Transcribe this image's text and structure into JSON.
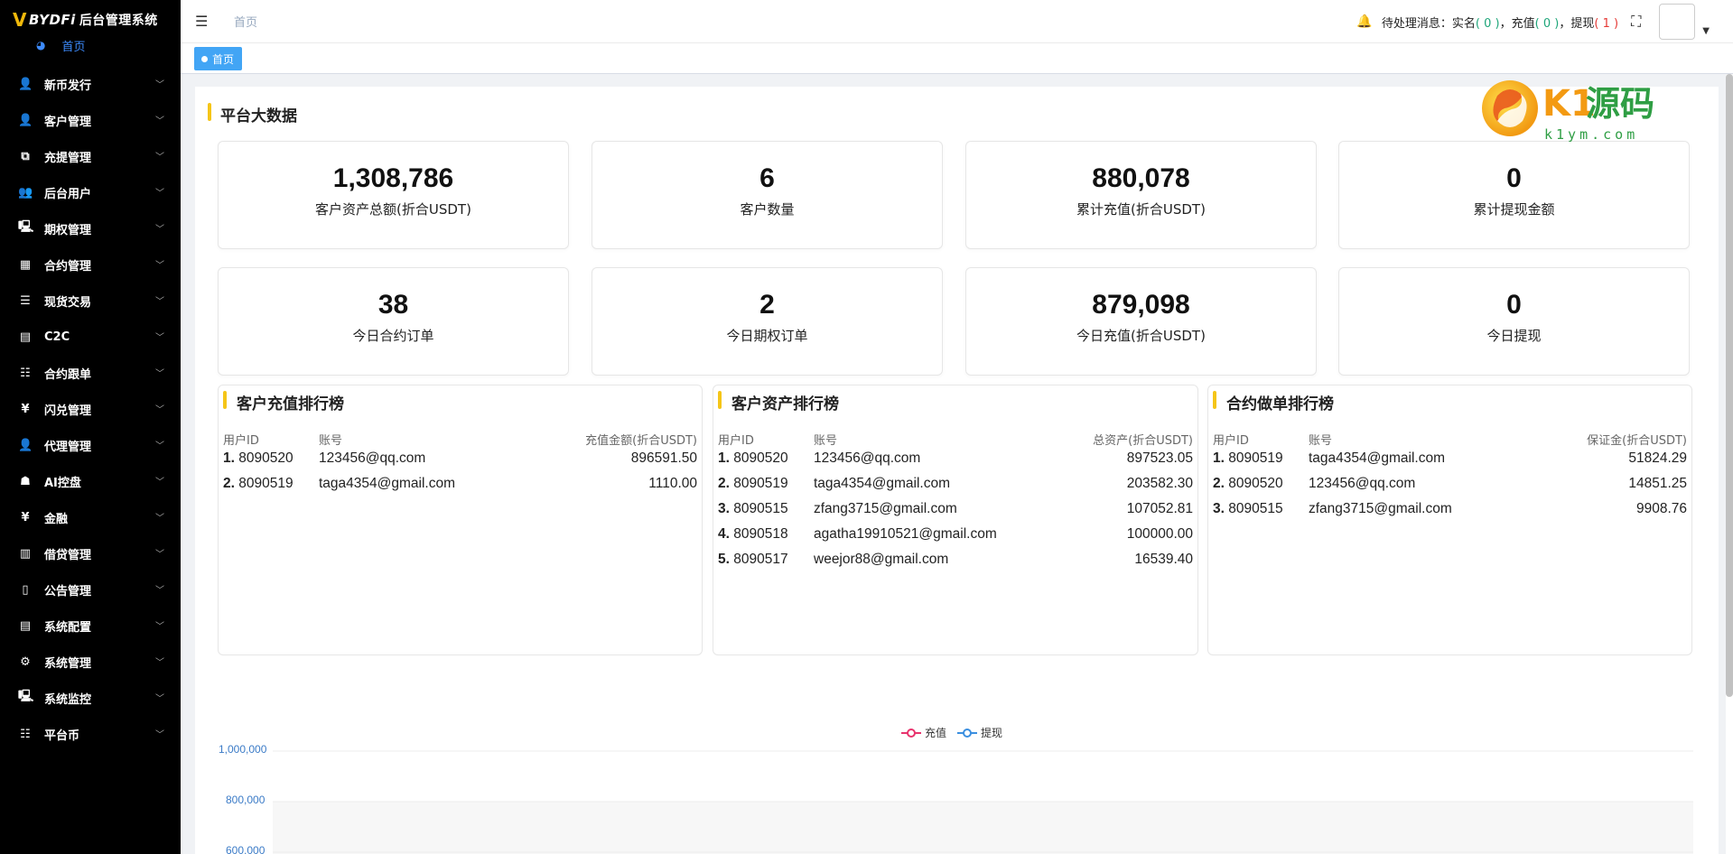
{
  "sidebar": {
    "logo_mark": "V",
    "logo_brand": "BYDFi",
    "logo_system": "后台管理系统",
    "home_label": "首页",
    "items": [
      {
        "label": "新币发行",
        "icon": "user-icon",
        "glyph": "👤"
      },
      {
        "label": "客户管理",
        "icon": "user-icon",
        "glyph": "👤"
      },
      {
        "label": "充提管理",
        "icon": "copy-icon",
        "glyph": "⧉"
      },
      {
        "label": "后台用户",
        "icon": "users-icon",
        "glyph": "👥"
      },
      {
        "label": "期权管理",
        "icon": "monitor-icon",
        "glyph": "🖳"
      },
      {
        "label": "合约管理",
        "icon": "table-icon",
        "glyph": "▦"
      },
      {
        "label": "现货交易",
        "icon": "list-icon",
        "glyph": "☰"
      },
      {
        "label": "C2C",
        "icon": "document-icon",
        "glyph": "▤"
      },
      {
        "label": "合约跟单",
        "icon": "list-ordered-icon",
        "glyph": "☷"
      },
      {
        "label": "闪兑管理",
        "icon": "yen-icon",
        "glyph": "¥"
      },
      {
        "label": "代理管理",
        "icon": "user-icon",
        "glyph": "👤"
      },
      {
        "label": "AI控盘",
        "icon": "robot-icon",
        "glyph": "☗"
      },
      {
        "label": "金融",
        "icon": "yen-icon",
        "glyph": "¥"
      },
      {
        "label": "借贷管理",
        "icon": "book-icon",
        "glyph": "▥"
      },
      {
        "label": "公告管理",
        "icon": "open-book-icon",
        "glyph": "▯"
      },
      {
        "label": "系统配置",
        "icon": "document-icon",
        "glyph": "▤"
      },
      {
        "label": "系统管理",
        "icon": "gear-icon",
        "glyph": "⚙"
      },
      {
        "label": "系统监控",
        "icon": "monitor-icon",
        "glyph": "🖳"
      },
      {
        "label": "平台币",
        "icon": "list-ordered-icon",
        "glyph": "☷"
      }
    ]
  },
  "topbar": {
    "breadcrumb": "首页",
    "pending_label": "待处理消息：",
    "realname_label": "实名",
    "realname_count": "0",
    "deposit_label": "充值",
    "deposit_count": "0",
    "withdraw_label": "提现",
    "withdraw_count": "1"
  },
  "tags": {
    "active": "首页"
  },
  "section_title": "平台大数据",
  "stats": [
    {
      "value": "1,308,786",
      "label": "客户资产总额(折合USDT)"
    },
    {
      "value": "6",
      "label": "客户数量"
    },
    {
      "value": "880,078",
      "label": "累计充值(折合USDT)"
    },
    {
      "value": "0",
      "label": "累计提现金额"
    },
    {
      "value": "38",
      "label": "今日合约订单"
    },
    {
      "value": "2",
      "label": "今日期权订单"
    },
    {
      "value": "879,098",
      "label": "今日充值(折合USDT)"
    },
    {
      "value": "0",
      "label": "今日提现"
    }
  ],
  "rankings": [
    {
      "title": "客户充值排行榜",
      "headers": [
        "用户ID",
        "账号",
        "充值金额(折合USDT)"
      ],
      "rows": [
        {
          "rank": "1.",
          "id": "8090520",
          "account": "123456@qq.com",
          "amount": "896591.50"
        },
        {
          "rank": "2.",
          "id": "8090519",
          "account": "taga4354@gmail.com",
          "amount": "1110.00"
        }
      ]
    },
    {
      "title": "客户资产排行榜",
      "headers": [
        "用户ID",
        "账号",
        "总资产(折合USDT)"
      ],
      "rows": [
        {
          "rank": "1.",
          "id": "8090520",
          "account": "123456@qq.com",
          "amount": "897523.05"
        },
        {
          "rank": "2.",
          "id": "8090519",
          "account": "taga4354@gmail.com",
          "amount": "203582.30"
        },
        {
          "rank": "3.",
          "id": "8090515",
          "account": "zfang3715@gmail.com",
          "amount": "107052.81"
        },
        {
          "rank": "4.",
          "id": "8090518",
          "account": "agatha19910521@gmail.com",
          "amount": "100000.00"
        },
        {
          "rank": "5.",
          "id": "8090517",
          "account": "weejor88@gmail.com",
          "amount": "16539.40"
        }
      ]
    },
    {
      "title": "合约做单排行榜",
      "headers": [
        "用户ID",
        "账号",
        "保证金(折合USDT)"
      ],
      "rows": [
        {
          "rank": "1.",
          "id": "8090519",
          "account": "taga4354@gmail.com",
          "amount": "51824.29"
        },
        {
          "rank": "2.",
          "id": "8090520",
          "account": "123456@qq.com",
          "amount": "14851.25"
        },
        {
          "rank": "3.",
          "id": "8090515",
          "account": "zfang3715@gmail.com",
          "amount": "9908.76"
        }
      ]
    }
  ],
  "chart_data": {
    "type": "line",
    "series": [
      {
        "name": "充值",
        "color": "#e8336d",
        "values": []
      },
      {
        "name": "提现",
        "color": "#3b8fe0",
        "values": []
      }
    ],
    "yticks": [
      "1,000,000",
      "800,000",
      "600,000"
    ],
    "ylim": [
      600000,
      1000000
    ],
    "grid": true,
    "legend": "top-center"
  },
  "watermark": {
    "text_main": "K1源码",
    "text_sub": "k1ym.com"
  },
  "colors": {
    "accent": "#42a5f5",
    "title_bar": "#f5c518",
    "sidebar_bg": "#000000"
  }
}
